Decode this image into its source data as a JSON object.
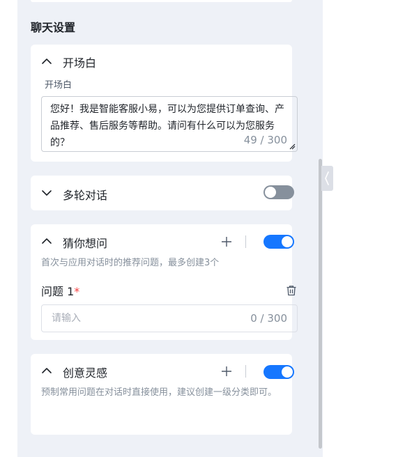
{
  "section_title": "聊天设置",
  "opening": {
    "title": "开场白",
    "field_label": "开场白",
    "text": "您好！我是智能客服小易，可以为您提供订单查询、产品推荐、售后服务等帮助。请问有什么可以为您服务的？",
    "counter": "49 / 300"
  },
  "multi_turn": {
    "title": "多轮对话",
    "enabled": false
  },
  "guess": {
    "title": "猜你想问",
    "enabled": true,
    "description": "首次与应用对话时的推荐问题，最多创建3个",
    "question_label": "问题 1",
    "required_mark": "*",
    "input_placeholder": "请输入",
    "input_counter": "0 / 300"
  },
  "inspiration": {
    "title": "创意灵感",
    "enabled": true,
    "description": "预制常用问题在对话时直接使用，建议创建一级分类即可。"
  },
  "colors": {
    "accent": "#1677ff",
    "toggle_off": "#86909c",
    "panel_bg": "#eef1f7"
  },
  "icons": {
    "collapse": "chevron-up-icon",
    "expand": "chevron-down-icon",
    "add": "plus-icon",
    "delete": "trash-icon",
    "sidebar_toggle": "chevron-left-icon"
  }
}
